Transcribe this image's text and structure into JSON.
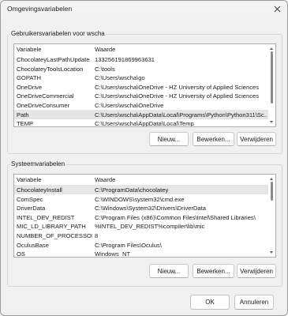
{
  "window": {
    "title": "Omgevingsvariabelen"
  },
  "user_vars": {
    "group_label": "Gebruikersvariabelen voor wscha",
    "headers": {
      "name": "Variabele",
      "value": "Waarde"
    },
    "rows": [
      {
        "name": "ChocolateyLastPathUpdate",
        "value": "133256191869963631"
      },
      {
        "name": "ChocolateyToolsLocation",
        "value": "C:\\tools"
      },
      {
        "name": "GOPATH",
        "value": "C:\\Users\\wscha\\go"
      },
      {
        "name": "OneDrive",
        "value": "C:\\Users\\wscha\\OneDrive - HZ University of Applied Sciences"
      },
      {
        "name": "OneDriveCommercial",
        "value": "C:\\Users\\wscha\\OneDrive - HZ University of Applied Sciences"
      },
      {
        "name": "OneDriveConsumer",
        "value": "C:\\Users\\wscha\\OneDrive"
      },
      {
        "name": "Path",
        "value": "C:\\Users\\wscha\\AppData\\Local\\Programs\\Python\\Python311\\Sc...",
        "selected": true
      },
      {
        "name": "TEMP",
        "value": "C:\\Users\\wscha\\AppData\\Local\\Temp"
      }
    ],
    "buttons": {
      "new": "Nieuw...",
      "edit": "Bewerken...",
      "delete": "Verwijderen"
    }
  },
  "system_vars": {
    "group_label": "Systeemvariabelen",
    "headers": {
      "name": "Variabele",
      "value": "Waarde"
    },
    "rows": [
      {
        "name": "ChocolateyInstall",
        "value": "C:\\ProgramData\\chocolatey",
        "selected": true
      },
      {
        "name": "ComSpec",
        "value": "C:\\WINDOWS\\system32\\cmd.exe"
      },
      {
        "name": "DriverData",
        "value": "C:\\Windows\\System32\\Drivers\\DriverData"
      },
      {
        "name": "INTEL_DEV_REDIST",
        "value": "C:\\Program Files (x86)\\Common Files\\Intel\\Shared Libraries\\"
      },
      {
        "name": "MIC_LD_LIBRARY_PATH",
        "value": "%INTEL_DEV_REDIST%compiler\\lib\\mic"
      },
      {
        "name": "NUMBER_OF_PROCESSORS",
        "value": "8"
      },
      {
        "name": "OculusBase",
        "value": "C:\\Program Files\\Oculus\\"
      },
      {
        "name": "OS",
        "value": "Windows_NT"
      }
    ],
    "buttons": {
      "new": "Nieuw...",
      "edit": "Bewerken...",
      "delete": "Verwijderen"
    }
  },
  "dialog_buttons": {
    "ok": "OK",
    "cancel": "Annuleren"
  }
}
